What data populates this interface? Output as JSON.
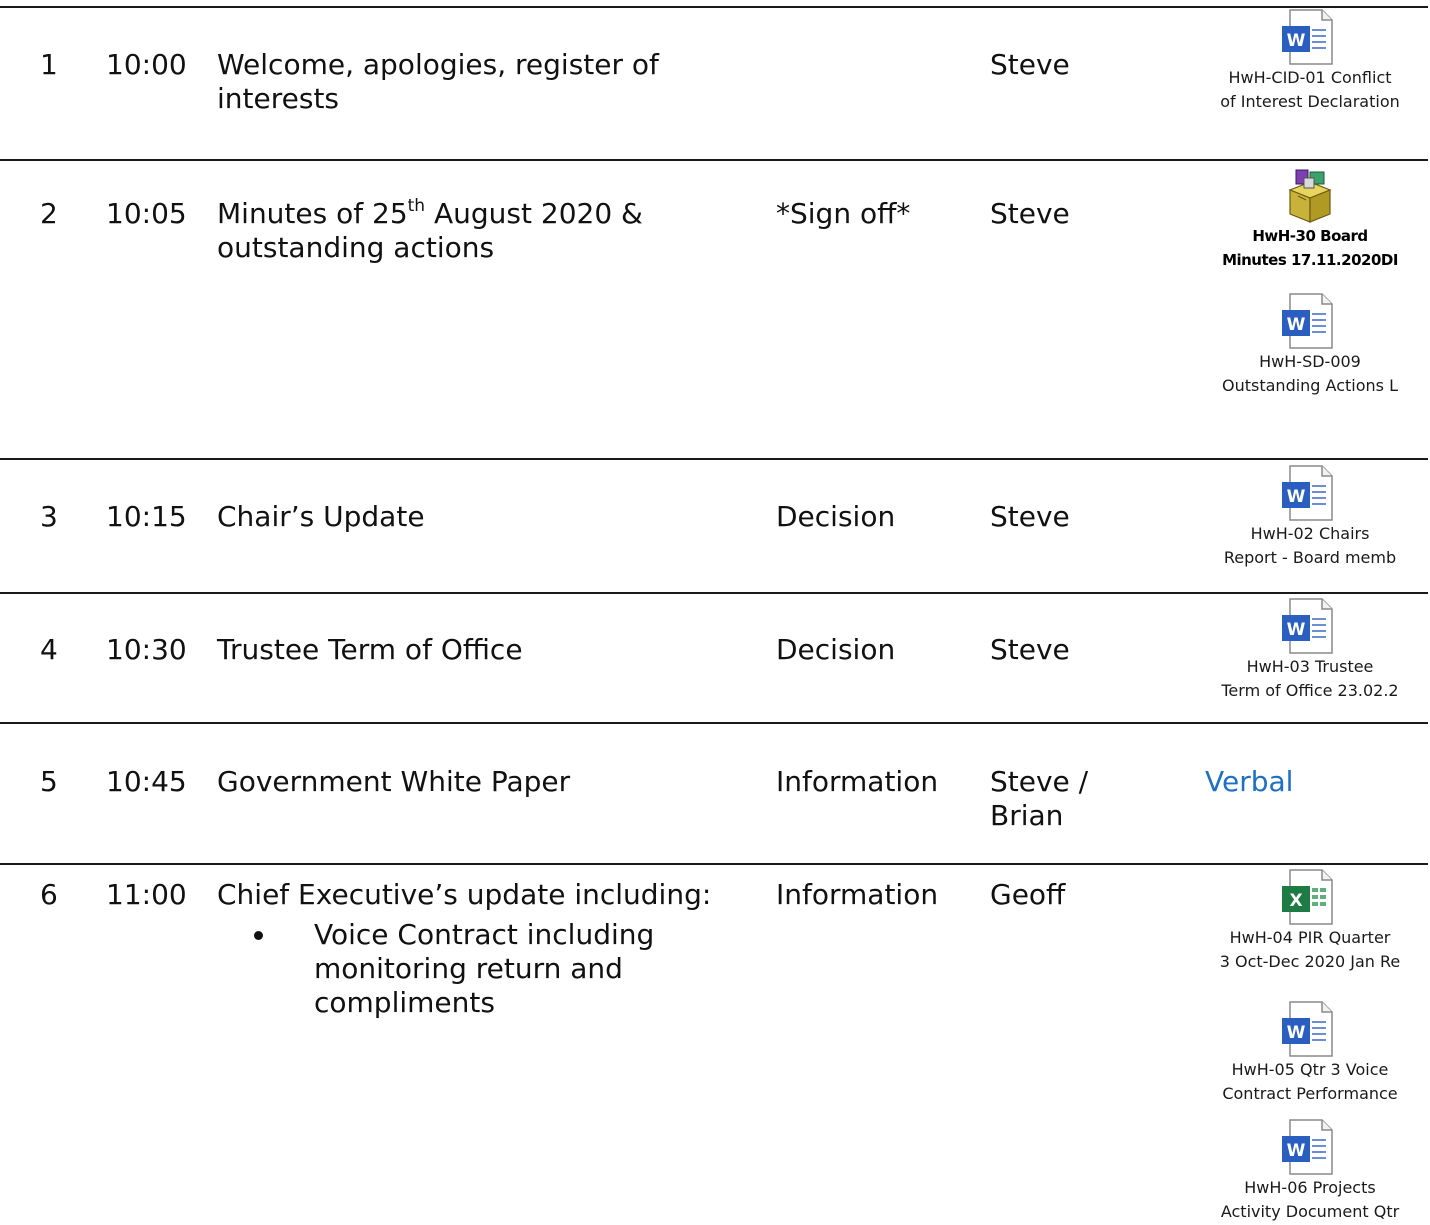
{
  "rows": [
    {
      "num": "1",
      "time": "10:00",
      "title": "Welcome, apologies, register of interests",
      "type": "",
      "lead": "Steve",
      "attachments": [
        {
          "icon": "word-doc-icon",
          "line1": "HwH-CID-01 Conflict",
          "line2": "of Interest Declaration"
        }
      ]
    },
    {
      "num": "2",
      "time": "10:05",
      "title_pre": "Minutes of 25",
      "title_sup": "th",
      "title_post": " August 2020 &",
      "title_line2": "outstanding actions",
      "type": "*Sign off*",
      "lead": "Steve",
      "attachments": [
        {
          "icon": "package-icon",
          "line1": "HwH-30 Board",
          "line2": "Minutes 17.11.2020DI"
        },
        {
          "icon": "word-doc-icon",
          "line1": "HwH-SD-009",
          "line2": "Outstanding Actions L"
        }
      ]
    },
    {
      "num": "3",
      "time": "10:15",
      "title": "Chair’s Update",
      "type": "Decision",
      "lead": "Steve",
      "attachments": [
        {
          "icon": "word-doc-icon",
          "line1": "HwH-02 Chairs",
          "line2": "Report - Board memb"
        }
      ]
    },
    {
      "num": "4",
      "time": "10:30",
      "title": "Trustee Term of Office",
      "type": "Decision",
      "lead": "Steve",
      "attachments": [
        {
          "icon": "word-doc-icon",
          "line1": "HwH-03 Trustee",
          "line2": "Term of Office 23.02.2"
        }
      ]
    },
    {
      "num": "5",
      "time": "10:45",
      "title": "Government White Paper",
      "type": "Information",
      "lead_line1": "Steve /",
      "lead_line2": "Brian",
      "verbal": "Verbal"
    },
    {
      "num": "6",
      "time": "11:00",
      "title": "Chief Executive’s update including:",
      "bullets": [
        "Voice Contract including monitoring return and compliments"
      ],
      "type": "Information",
      "lead": "Geoff",
      "attachments": [
        {
          "icon": "excel-doc-icon",
          "line1": "HwH-04 PIR Quarter",
          "line2": "3 Oct-Dec 2020 Jan Re"
        },
        {
          "icon": "word-doc-icon",
          "line1": "HwH-05 Qtr 3 Voice",
          "line2": "Contract Performance"
        },
        {
          "icon": "word-doc-icon",
          "line1": "HwH-06 Projects",
          "line2": "Activity Document Qtr"
        }
      ]
    }
  ],
  "colors": {
    "word": "#2b5fbf",
    "excel": "#1e7b43",
    "link": "#1f6fc2",
    "rule": "#1a1a1a"
  }
}
